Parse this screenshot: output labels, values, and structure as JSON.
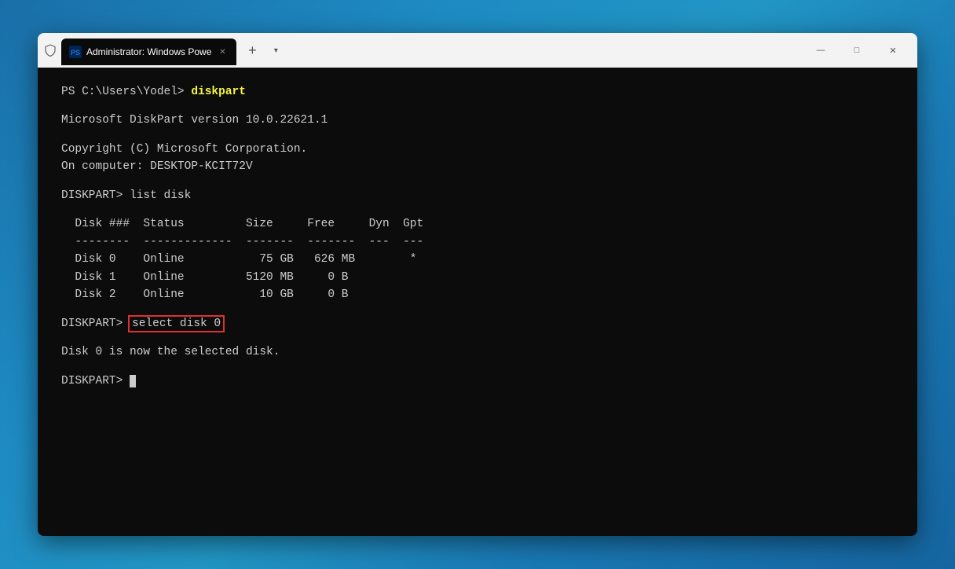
{
  "window": {
    "titlebar": {
      "tab_title": "Administrator: Windows Powe",
      "new_tab_label": "+",
      "dropdown_label": "▾"
    },
    "controls": {
      "minimize": "—",
      "maximize": "□",
      "close": "✕"
    }
  },
  "terminal": {
    "lines": [
      {
        "id": "prompt1",
        "prefix": "PS C:\\Users\\Yodel> ",
        "cmd": "diskpart",
        "highlight": true
      },
      {
        "id": "blank1",
        "text": ""
      },
      {
        "id": "version",
        "text": "Microsoft DiskPart version 10.0.22621.1"
      },
      {
        "id": "blank2",
        "text": ""
      },
      {
        "id": "copyright",
        "text": "Copyright (C) Microsoft Corporation."
      },
      {
        "id": "computer",
        "text": "On computer: DESKTOP-KCIT72V"
      },
      {
        "id": "blank3",
        "text": ""
      },
      {
        "id": "listdisk_prompt",
        "text": "DISKPART> list disk"
      },
      {
        "id": "blank4",
        "text": ""
      },
      {
        "id": "header",
        "text": "  Disk ###  Status         Size     Free     Dyn  Gpt"
      },
      {
        "id": "divider",
        "text": "  --------  -------------  -------  -------  ---  ---"
      },
      {
        "id": "disk0",
        "text": "  Disk 0    Online           75 GB   626 MB        *"
      },
      {
        "id": "disk1",
        "text": "  Disk 1    Online         5120 MB     0 B"
      },
      {
        "id": "disk2",
        "text": "  Disk 2    Online           10 GB     0 B"
      },
      {
        "id": "blank5",
        "text": ""
      },
      {
        "id": "select_prompt_pre",
        "prefix": "DISKPART> ",
        "cmd": "select disk 0",
        "boxed": true
      },
      {
        "id": "blank6",
        "text": ""
      },
      {
        "id": "selected_msg",
        "text": "Disk 0 is now the selected disk."
      },
      {
        "id": "blank7",
        "text": ""
      },
      {
        "id": "final_prompt",
        "text": "DISKPART> "
      }
    ]
  }
}
